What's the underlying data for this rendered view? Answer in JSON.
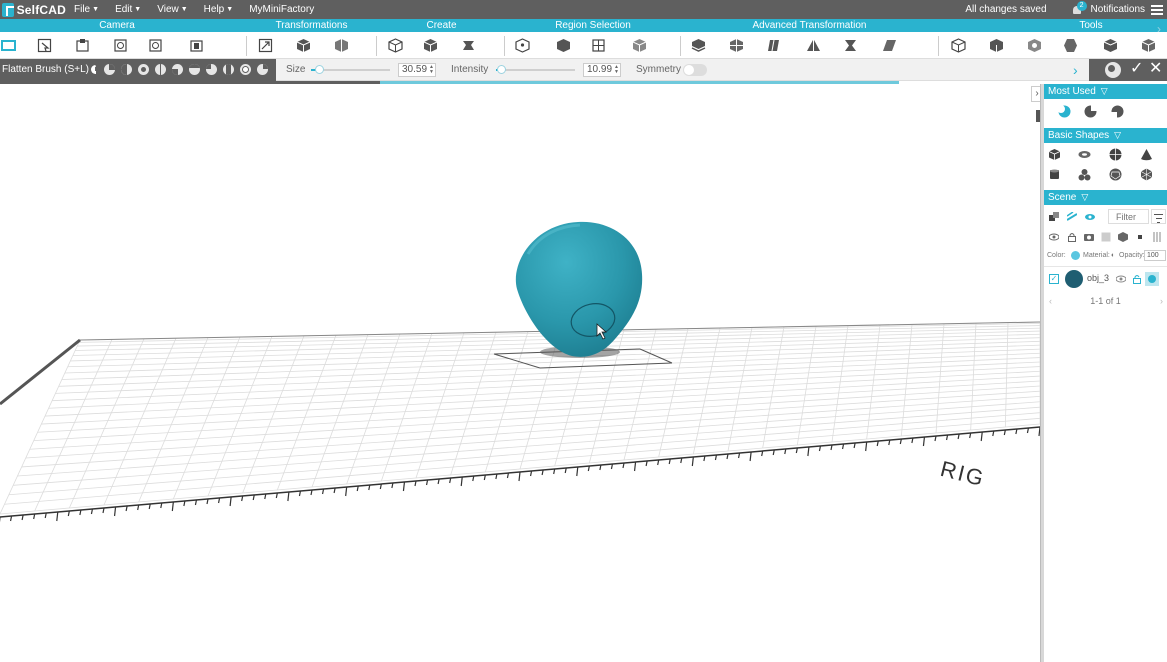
{
  "app": {
    "logo_text": "SelfCAD",
    "save_status": "All changes saved",
    "notifications_label": "Notifications",
    "notifications_count": "2"
  },
  "menu": [
    {
      "label": "File"
    },
    {
      "label": "Edit"
    },
    {
      "label": "View"
    },
    {
      "label": "Help"
    },
    {
      "label": "MyMiniFactory"
    }
  ],
  "categories": {
    "camera": "Camera",
    "transformations": "Transformations",
    "create": "Create",
    "region_selection": "Region Selection",
    "advanced_transformation": "Advanced Transformation",
    "tools": "Tools"
  },
  "brush": {
    "name": "Flatten Brush (S+L)",
    "size_label": "Size",
    "size_value": "30.59",
    "size_level": 0.08,
    "intensity_label": "Intensity",
    "intensity_value": "10.99",
    "intensity_level": 0.04,
    "symmetry_label": "Symmetry",
    "symmetry_on": false
  },
  "progress_level": 0.66,
  "panel": {
    "most_used_title": "Most Used",
    "basic_shapes_title": "Basic Shapes",
    "scene_title": "Scene",
    "filter_placeholder": "Filter",
    "color_label": "Color:",
    "material_label": "Material:",
    "opacity_label": "Opacity:",
    "opacity_value": "100",
    "objects": [
      {
        "name": "obj_3",
        "checked": true
      }
    ],
    "pagination": "1-1 of 1"
  },
  "viewport": {
    "ruler_text": "RIG",
    "object_color": "#2a97ab"
  },
  "colors": {
    "accent": "#2ab3cf",
    "menubar": "#5f5f5f"
  }
}
